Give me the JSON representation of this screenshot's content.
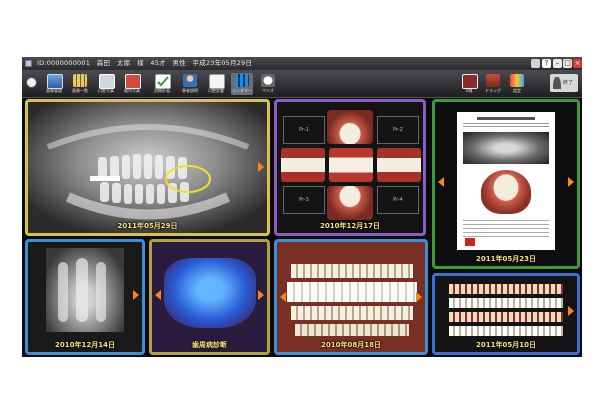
{
  "window": {
    "patient_line": "ID:0000000001　森田　太郎　様　45才　男性　平成23年05月29日"
  },
  "toolbar": {
    "tools": [
      {
        "label": "画像管理",
        "icon": "monitor-icon"
      },
      {
        "label": "画像一覧",
        "icon": "grid-icon"
      },
      {
        "label": "口腔写真",
        "icon": "camera-icon"
      },
      {
        "label": "歯列写真",
        "icon": "dentition-icon"
      },
      {
        "label": "治療計画",
        "icon": "checklist-icon"
      },
      {
        "label": "患者説明",
        "icon": "person-icon"
      },
      {
        "label": "口腔診査",
        "icon": "document-icon"
      },
      {
        "label": "ランダマー",
        "icon": "layout-icon"
      },
      {
        "label": "ペリオ",
        "icon": "tooth-icon"
      }
    ],
    "right_tools": [
      {
        "label": "X線",
        "icon": "scanner-icon"
      },
      {
        "label": "ドラッグ",
        "icon": "tray-icon"
      },
      {
        "label": "設定",
        "icon": "palette-icon"
      }
    ],
    "exit_label": "終了"
  },
  "tiles": {
    "panoramic": {
      "date": "2011年05月29日"
    },
    "intraoral": {
      "date": "2010年12月17日",
      "slots": [
        "Pr-1",
        "Pr-2",
        "Pr-3",
        "Pr-4"
      ]
    },
    "report": {
      "date": "2011年05月23日"
    },
    "periapical": {
      "date": "2010年12月14日"
    },
    "fluorescence": {
      "date": "歯周病診断"
    },
    "shade": {
      "date": "2010年08月18日"
    },
    "chart": {
      "date": "2011年05月10日"
    }
  },
  "colors": {
    "panoramic_border": "#d9c24a",
    "intraoral_border": "#8a5fc0",
    "report_border": "#3e9a3a",
    "periapical_border": "#3b8fd6",
    "fluorescence_border": "#b2a33c",
    "shade_border": "#3b8fd6",
    "chart_border": "#3b6fd6",
    "arrow": "#f08a1c",
    "date_text": "#f6e37a"
  }
}
